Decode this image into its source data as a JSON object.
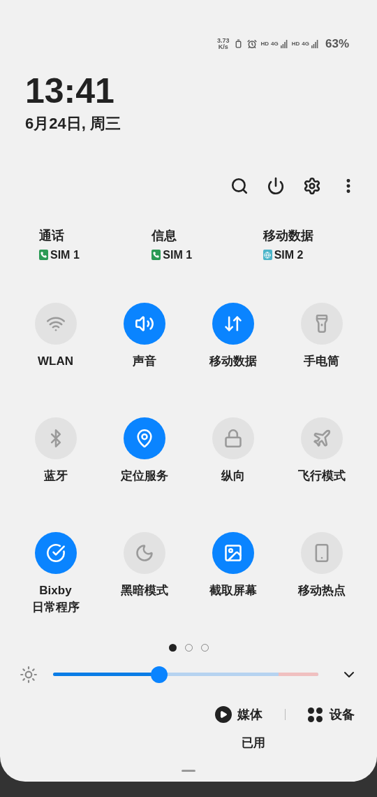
{
  "status_bar": {
    "speed_value": "3.73",
    "speed_unit": "K/s",
    "sim_slots": [
      {
        "hd": "HD",
        "network": "4G"
      },
      {
        "hd": "HD",
        "network": "4G"
      }
    ],
    "battery": "63%"
  },
  "clock": {
    "time": "13:41",
    "date": "6月24日, 周三"
  },
  "sim_settings": [
    {
      "title": "通话",
      "sim": "SIM 1",
      "kind": "call"
    },
    {
      "title": "信息",
      "sim": "SIM 1",
      "kind": "call"
    },
    {
      "title": "移动数据",
      "sim": "SIM 2",
      "kind": "data"
    }
  ],
  "tiles": [
    {
      "kind": "wifi",
      "label": "WLAN",
      "on": false
    },
    {
      "kind": "sound",
      "label": "声音",
      "on": true
    },
    {
      "kind": "data",
      "label": "移动数据",
      "on": true
    },
    {
      "kind": "flashlight",
      "label": "手电筒",
      "on": false
    },
    {
      "kind": "bluetooth",
      "label": "蓝牙",
      "on": false
    },
    {
      "kind": "location",
      "label": "定位服务",
      "on": true
    },
    {
      "kind": "orientation",
      "label": "纵向",
      "on": false
    },
    {
      "kind": "airplane",
      "label": "飞行模式",
      "on": false
    },
    {
      "kind": "bixby",
      "label": "Bixby\n日常程序",
      "on": true
    },
    {
      "kind": "dark",
      "label": "黑暗模式",
      "on": false
    },
    {
      "kind": "screenshot",
      "label": "截取屏幕",
      "on": true
    },
    {
      "kind": "hotspot",
      "label": "移动热点",
      "on": false
    }
  ],
  "pages": [
    {
      "selected": true
    },
    {
      "selected": false
    },
    {
      "selected": false
    }
  ],
  "brightness": {
    "level": 0.4
  },
  "media_button": "媒体",
  "devices_button": "设备",
  "storage": "已用"
}
